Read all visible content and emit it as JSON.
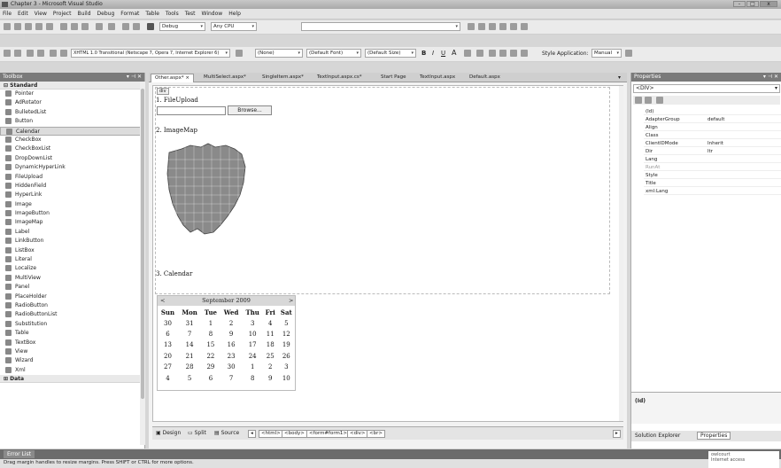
{
  "window": {
    "title": "Chapter 3 - Microsoft Visual Studio",
    "controls": [
      "-",
      "□",
      "x"
    ]
  },
  "menu": [
    "File",
    "Edit",
    "View",
    "Project",
    "Build",
    "Debug",
    "Format",
    "Table",
    "Tools",
    "Test",
    "Window",
    "Help"
  ],
  "toolbar1": {
    "config": "Debug",
    "platform": "Any CPU",
    "find": ""
  },
  "toolbar2": {
    "schema": "XHTML 1.0 Transitional (Netscape 7, Opera 7, Internet Explorer 6)",
    "style_block": "(None)",
    "font": "(Default Font)",
    "size": "(Default Size)",
    "style_app_label": "Style Application:",
    "style_app_value": "Manual"
  },
  "toolbox": {
    "title": "Toolbox",
    "category": "Standard",
    "selected": "Calendar",
    "items": [
      "Pointer",
      "AdRotator",
      "BulletedList",
      "Button",
      "Calendar",
      "CheckBox",
      "CheckBoxList",
      "DropDownList",
      "DynamicHyperLink",
      "FileUpload",
      "HiddenField",
      "HyperLink",
      "Image",
      "ImageButton",
      "ImageMap",
      "Label",
      "LinkButton",
      "ListBox",
      "Literal",
      "Localize",
      "MultiView",
      "Panel",
      "PlaceHolder",
      "RadioButton",
      "RadioButtonList",
      "Substitution",
      "Table",
      "TextBox",
      "View",
      "Wizard",
      "Xml"
    ],
    "next_category": "Data"
  },
  "tabs": [
    "Other.aspx*",
    "MultiSelect.aspx*",
    "SingleItem.aspx*",
    "TextInput.aspx.cs*",
    "Start Page",
    "TextInput.aspx",
    "Default.aspx"
  ],
  "tab_close": "×",
  "design": {
    "div_tag": "div",
    "h1": "1. FileUpload",
    "browse": "Browse...",
    "h2": "2. ImageMap",
    "h3": "3. Calendar",
    "calendar": {
      "month": "September 2009",
      "prev": "<",
      "next": ">",
      "days": [
        "Sun",
        "Mon",
        "Tue",
        "Wed",
        "Thu",
        "Fri",
        "Sat"
      ],
      "weeks": [
        [
          "30",
          "31",
          "1",
          "2",
          "3",
          "4",
          "5"
        ],
        [
          "6",
          "7",
          "8",
          "9",
          "10",
          "11",
          "12"
        ],
        [
          "13",
          "14",
          "15",
          "16",
          "17",
          "18",
          "19"
        ],
        [
          "20",
          "21",
          "22",
          "23",
          "24",
          "25",
          "26"
        ],
        [
          "27",
          "28",
          "29",
          "30",
          "1",
          "2",
          "3"
        ],
        [
          "4",
          "5",
          "6",
          "7",
          "8",
          "9",
          "10"
        ]
      ]
    }
  },
  "viewbar": {
    "design": "Design",
    "split": "Split",
    "source": "Source",
    "crumbs": [
      "<html>",
      "<body>",
      "<form#form1>",
      "<div>",
      "<br>"
    ]
  },
  "properties": {
    "title": "Properties",
    "object": "<DIV>",
    "rows": [
      {
        "name": "(Id)",
        "value": ""
      },
      {
        "name": "AdapterGroup",
        "value": "default"
      },
      {
        "name": "Align",
        "value": ""
      },
      {
        "name": "Class",
        "value": ""
      },
      {
        "name": "ClientIDMode",
        "value": "Inherit"
      },
      {
        "name": "Dir",
        "value": "ltr"
      },
      {
        "name": "Lang",
        "value": ""
      },
      {
        "name": "RunAt",
        "value": ""
      },
      {
        "name": "Style",
        "value": ""
      },
      {
        "name": "Title",
        "value": ""
      },
      {
        "name": "xml:Lang",
        "value": ""
      }
    ],
    "desc": "(Id)",
    "tabs": [
      "Solution Explorer",
      "Properties"
    ]
  },
  "errorlist": "Error List",
  "status": "Drag margin handles to resize margins. Press SHIFT or CTRL for more options.",
  "tray": [
    "owlcourt",
    "Internet access"
  ]
}
